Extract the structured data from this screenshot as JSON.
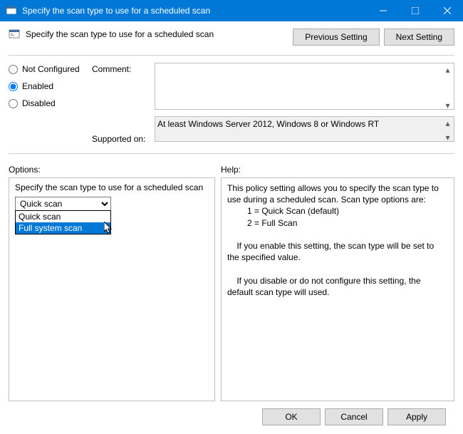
{
  "titlebar": {
    "text": "Specify the scan type to use for a scheduled scan"
  },
  "header": {
    "title": "Specify the scan type to use for a scheduled scan"
  },
  "nav": {
    "prev": "Previous Setting",
    "next": "Next Setting"
  },
  "radios": {
    "not_configured": "Not Configured",
    "enabled": "Enabled",
    "disabled": "Disabled",
    "selected": "enabled"
  },
  "labels": {
    "comment": "Comment:",
    "supported": "Supported on:",
    "options": "Options:",
    "help": "Help:"
  },
  "comment": {
    "value": ""
  },
  "supported": {
    "value": "At least Windows Server 2012, Windows 8 or Windows RT"
  },
  "options": {
    "desc": "Specify the scan type to use for a scheduled scan",
    "selected": "Quick scan",
    "items": [
      "Quick scan",
      "Full system scan"
    ],
    "highlighted_index": 1
  },
  "help": {
    "line1": "This policy setting allows you to specify the scan type to use during a scheduled scan. Scan type options are:",
    "line2": "1 = Quick Scan (default)",
    "line3": "2 = Full Scan",
    "line4": "If you enable this setting, the scan type will be set to the specified value.",
    "line5": "If you disable or do not configure this setting, the default scan type will used."
  },
  "footer": {
    "ok": "OK",
    "cancel": "Cancel",
    "apply": "Apply"
  }
}
